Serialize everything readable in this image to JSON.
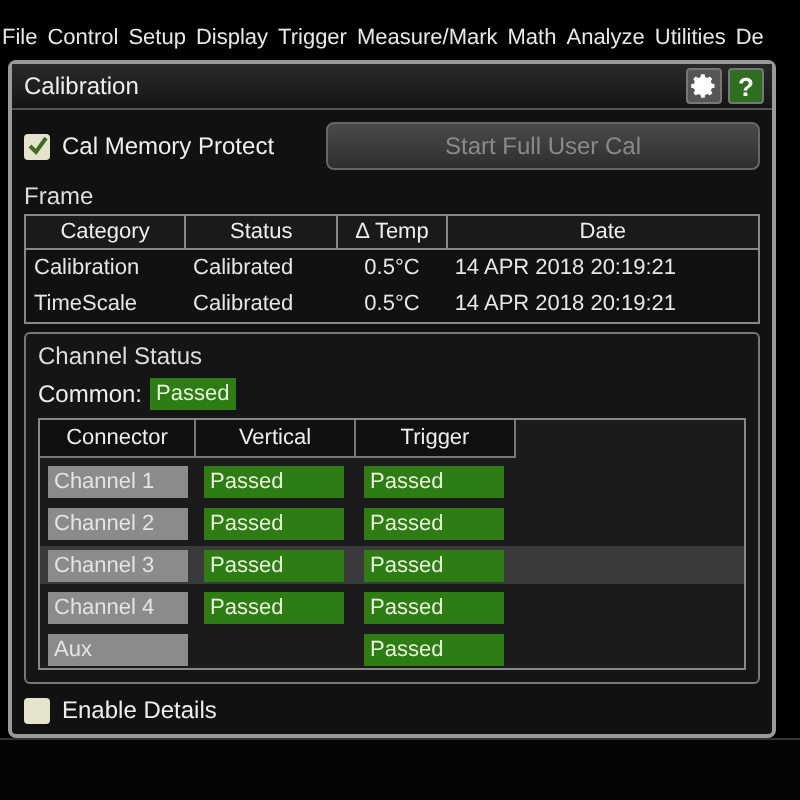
{
  "menu": [
    "File",
    "Control",
    "Setup",
    "Display",
    "Trigger",
    "Measure/Mark",
    "Math",
    "Analyze",
    "Utilities",
    "De"
  ],
  "dialog": {
    "title": "Calibration",
    "help": "?",
    "cal_memory_protect": {
      "label": "Cal Memory Protect",
      "checked": true
    },
    "start_button": {
      "label": "Start Full User Cal",
      "disabled": true
    },
    "frame": {
      "title": "Frame",
      "columns": [
        "Category",
        "Status",
        "Δ Temp",
        "Date"
      ],
      "rows": [
        [
          "Calibration",
          "Calibrated",
          "0.5°C",
          "14 APR 2018 20:19:21"
        ],
        [
          "TimeScale",
          "Calibrated",
          "0.5°C",
          "14 APR 2018 20:19:21"
        ]
      ]
    },
    "channel_status": {
      "title": "Channel Status",
      "common_label": "Common:",
      "common_value": "Passed",
      "columns": [
        "Connector",
        "Vertical",
        "Trigger"
      ],
      "rows": [
        {
          "connector": "Channel 1",
          "vertical": "Passed",
          "trigger": "Passed",
          "selected": false
        },
        {
          "connector": "Channel 2",
          "vertical": "Passed",
          "trigger": "Passed",
          "selected": false
        },
        {
          "connector": "Channel 3",
          "vertical": "Passed",
          "trigger": "Passed",
          "selected": true
        },
        {
          "connector": "Channel 4",
          "vertical": "Passed",
          "trigger": "Passed",
          "selected": false
        },
        {
          "connector": "Aux",
          "trigger": "Passed",
          "selected": false
        }
      ]
    },
    "enable_details": {
      "label": "Enable Details",
      "checked": false
    }
  }
}
